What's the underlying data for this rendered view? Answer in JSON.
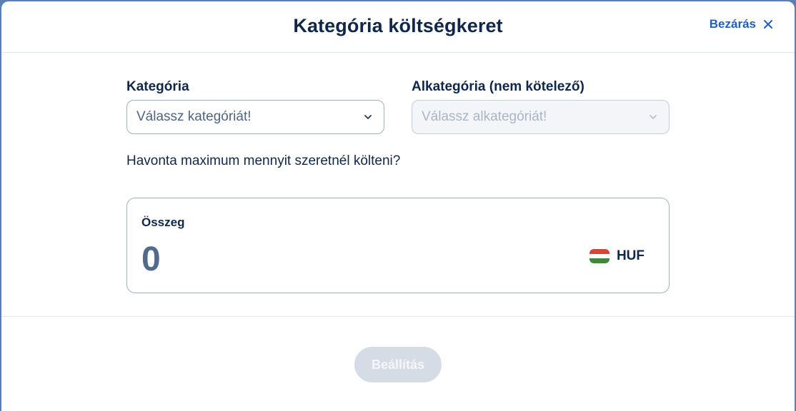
{
  "modal": {
    "title": "Kategória költségkeret",
    "close_label": "Bezárás"
  },
  "category": {
    "label": "Kategória",
    "placeholder": "Válassz kategóriát!"
  },
  "subcategory": {
    "label": "Alkategória (nem kötelező)",
    "placeholder": "Válassz alkategóriát!",
    "disabled": true
  },
  "question": "Havonta maximum mennyit szeretnél költeni?",
  "amount": {
    "label": "Összeg",
    "value": "0",
    "currency": "HUF",
    "flag_colors": [
      "#d9433c",
      "#ffffff",
      "#3f8a3a"
    ]
  },
  "submit": {
    "label": "Beállítás",
    "disabled": true
  },
  "icons": {
    "close": "close-icon",
    "dropdown": "chevron-down-icon",
    "flag": "hungary-flag-icon"
  },
  "colors": {
    "primary_text": "#11274a",
    "link": "#1f5fbf",
    "border": "#9fb0c7",
    "disabled_button": "#d5dce6"
  }
}
